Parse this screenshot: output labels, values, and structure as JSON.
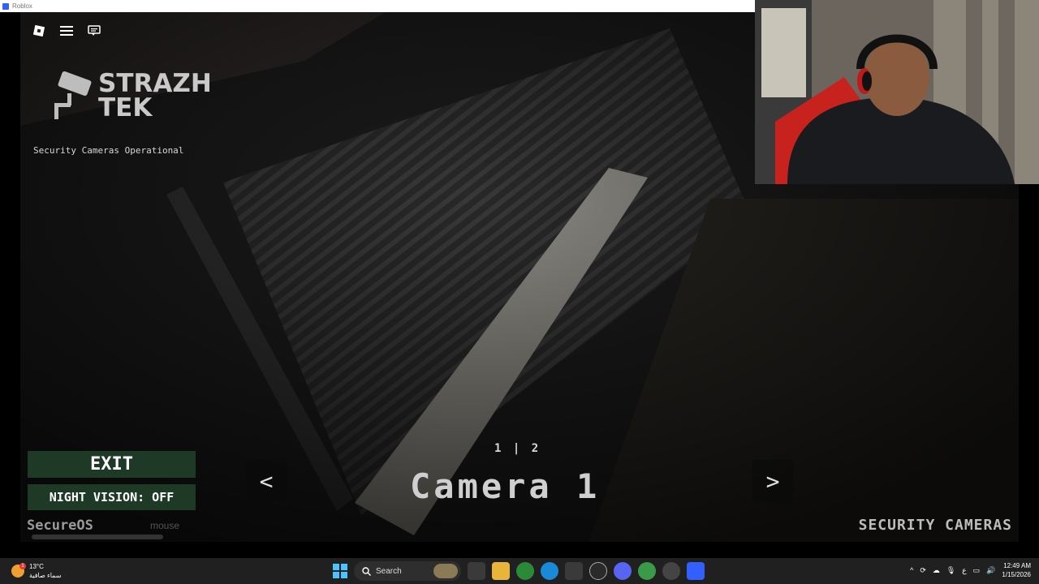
{
  "window": {
    "title": "Roblox"
  },
  "overlay": {
    "logo_line1": "STRAZH",
    "logo_line2": "TEK",
    "status": "Security Cameras Operational",
    "exit_label": "EXIT",
    "night_vision_label": "NIGHT VISION: OFF",
    "os_label": "SecureOS",
    "mouse_hint": "mouse",
    "pager": "1 | 2",
    "prev_label": "<",
    "next_label": ">",
    "camera_label": "Camera 1",
    "section_label": "SECURITY CAMERAS"
  },
  "taskbar": {
    "weather_temp": "13°C",
    "weather_desc": "سماء صافية",
    "weather_badge": "1",
    "search_label": "Search",
    "tray_lang": "ع",
    "time": "12:49 AM",
    "date": "1/15/2026"
  },
  "colors": {
    "button_bg": "#1e3a27",
    "title_bar": "#ffffff",
    "taskbar_bg": "#202020",
    "windows_accent": "#4cc2ff"
  }
}
